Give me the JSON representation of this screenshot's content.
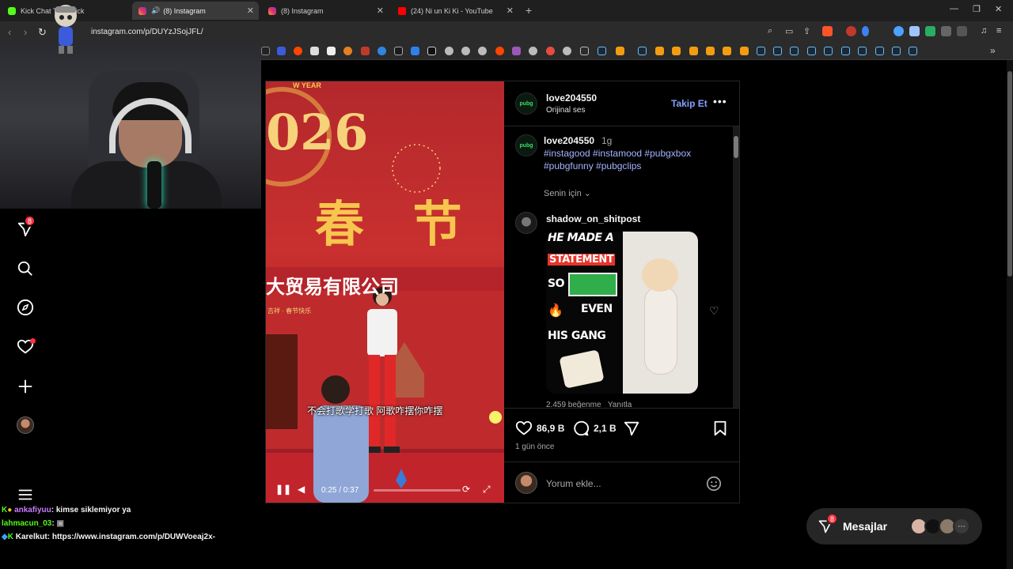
{
  "browser": {
    "tabs": [
      {
        "label": "Kick Chat Tab - Kick",
        "icon": "kick-icon"
      },
      {
        "label": "(8) Instagram",
        "icon": "instagram-icon",
        "active": true,
        "audio": true
      },
      {
        "label": "(8) Instagram",
        "icon": "instagram-icon"
      },
      {
        "label": "(24) Ni un Ki Ki - YouTube",
        "icon": "youtube-icon"
      }
    ],
    "url": "instagram.com/p/DUYzJSojJFL/"
  },
  "post": {
    "author": "love204550",
    "audio": "Orijinal ses",
    "follow_label": "Takip Et",
    "caption_author": "love204550",
    "caption_time": "1g",
    "hashtags": "#instagood #instamood #pubgxbox #pubgfunny #pubgclips",
    "for_you": "Senin için",
    "comment": {
      "author": "shadow_on_shitpost",
      "gif_lines": [
        "HE MADE A",
        "STATEMENT",
        "SO",
        "EVEN",
        "HIS GANG"
      ],
      "likes": "2.459 beğenme",
      "reply": "Yanıtla"
    },
    "likes_count": "86,9 B",
    "comments_count": "2,1 B",
    "posted": "1 gün önce",
    "comment_placeholder": "Yorum ekle..."
  },
  "video": {
    "subtitle": "不会打歌学打歌 阿歌咋摆你咋摆",
    "banner_top": "W YEAR",
    "banner_chars": "春 节",
    "banner_company": "大贸易有限公司",
    "banner_small": "吉祥 · 春节快乐",
    "time": "0:25 / 0:37"
  },
  "sidebar": {
    "notifications_badge": "8"
  },
  "messages": {
    "label": "Mesajlar",
    "badge": "8"
  },
  "chat": [
    {
      "user": "ankafiyuu",
      "text": ": kimse siklemiyor ya",
      "color": "#c77dff"
    },
    {
      "user": "lahmacun_03",
      "text": ": ",
      "color": "#53fc18"
    },
    {
      "user": "Karelkut",
      "text": ": https://www.instagram.com/p/DUWVoeaj2x-",
      "color": "#ffffff"
    }
  ],
  "colors": {
    "accent_blue": "#85a1ff",
    "hashtag": "#a3b4ff",
    "badge_red": "#ff3040",
    "kick_green": "#53fc18"
  }
}
